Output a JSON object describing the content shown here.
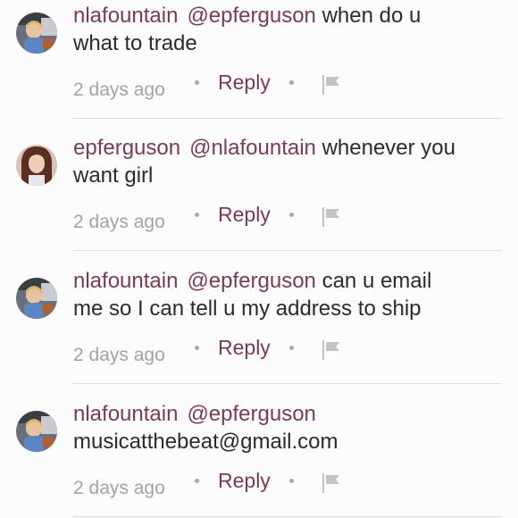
{
  "comments": [
    {
      "username": "nlafountain",
      "mention": "@epferguson",
      "text_line1": "when do u",
      "text_line2": "what to trade",
      "timestamp": "2 days ago",
      "reply_label": "Reply",
      "avatar": "child-avatar-icon"
    },
    {
      "username": "epferguson",
      "mention": "@nlafountain",
      "text_line1": "whenever you",
      "text_line2": "want girl",
      "timestamp": "2 days ago",
      "reply_label": "Reply",
      "avatar": "woman-avatar-icon"
    },
    {
      "username": "nlafountain",
      "mention": "@epferguson",
      "text_line1": "can u email",
      "text_line2": "me so I can tell u my address to ship",
      "timestamp": "2 days ago",
      "reply_label": "Reply",
      "avatar": "child-avatar-icon"
    },
    {
      "username": "nlafountain",
      "mention": "@epferguson",
      "text_line1": "",
      "text_line2": "musicatthebeat@gmail.com",
      "timestamp": "2 days ago",
      "reply_label": "Reply",
      "avatar": "child-avatar-icon"
    }
  ],
  "colors": {
    "accent": "#7a3d4f",
    "muted": "#a3a3a3",
    "text": "#2b2b2b"
  }
}
